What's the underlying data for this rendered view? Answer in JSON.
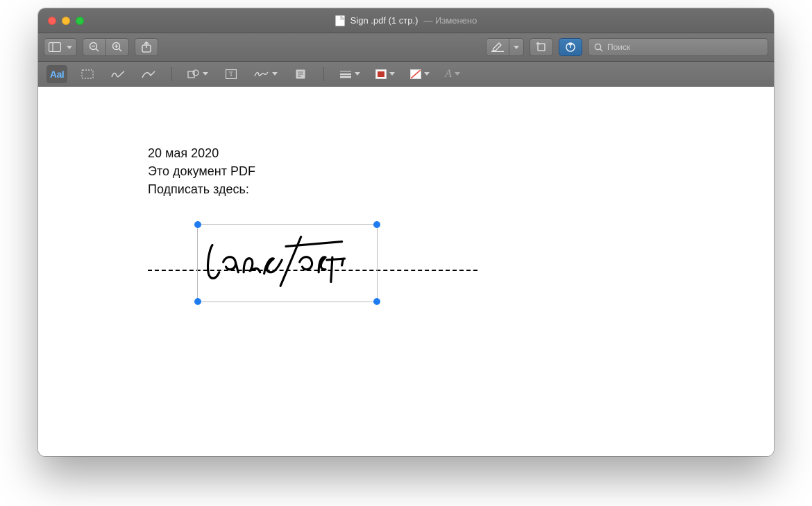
{
  "window": {
    "title": "Sign .pdf (1 стр.)",
    "status": "Изменено"
  },
  "search": {
    "placeholder": "Поиск"
  },
  "markup": {
    "text_style_label": "AaI"
  },
  "document": {
    "line1": "20 мая 2020",
    "line2": "Это документ PDF",
    "line3": "Подписать здесь:"
  }
}
